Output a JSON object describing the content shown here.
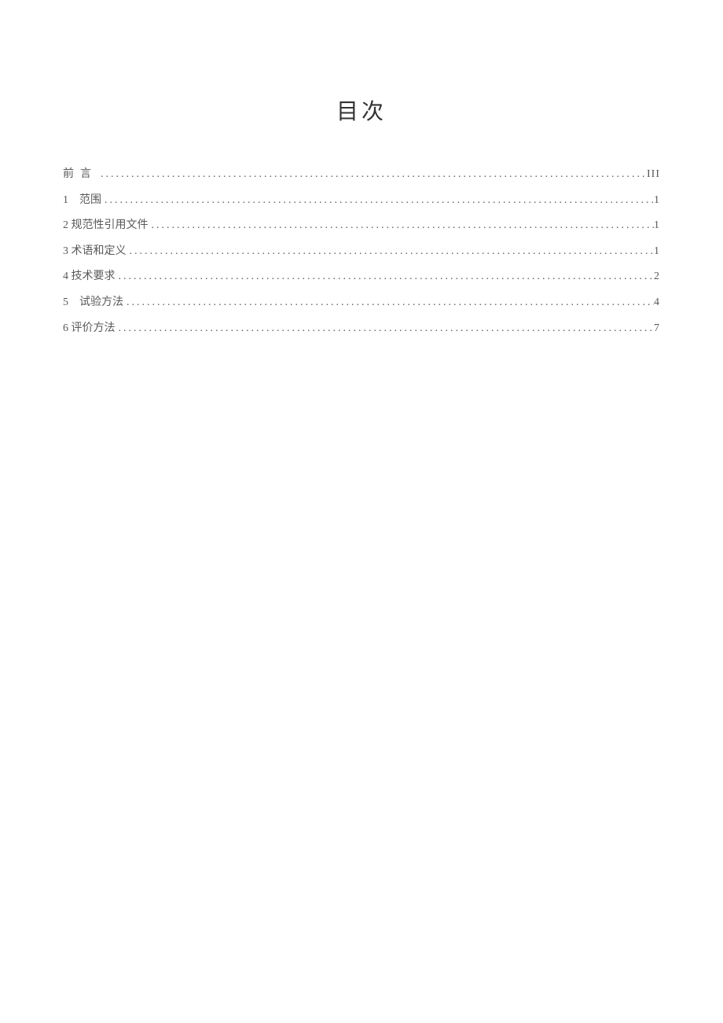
{
  "title": "目次",
  "toc": [
    {
      "number": "",
      "text": "前言",
      "page": "III",
      "spaced": false,
      "letterSpacing": "8px"
    },
    {
      "number": "1",
      "text": "范围",
      "page": "1",
      "spaced": true,
      "letterSpacing": "0px"
    },
    {
      "number": "2",
      "text": "规范性引用文件",
      "page": "1",
      "spaced": false,
      "letterSpacing": "0px"
    },
    {
      "number": "3",
      "text": "术语和定义",
      "page": "1",
      "spaced": false,
      "letterSpacing": "0px"
    },
    {
      "number": "4",
      "text": "技术要求",
      "page": "2",
      "spaced": false,
      "letterSpacing": "0px"
    },
    {
      "number": "5",
      "text": "试验方法",
      "page": "4",
      "spaced": true,
      "letterSpacing": "0px"
    },
    {
      "number": "6",
      "text": "评价方法",
      "page": "7",
      "spaced": false,
      "letterSpacing": "0px"
    }
  ]
}
